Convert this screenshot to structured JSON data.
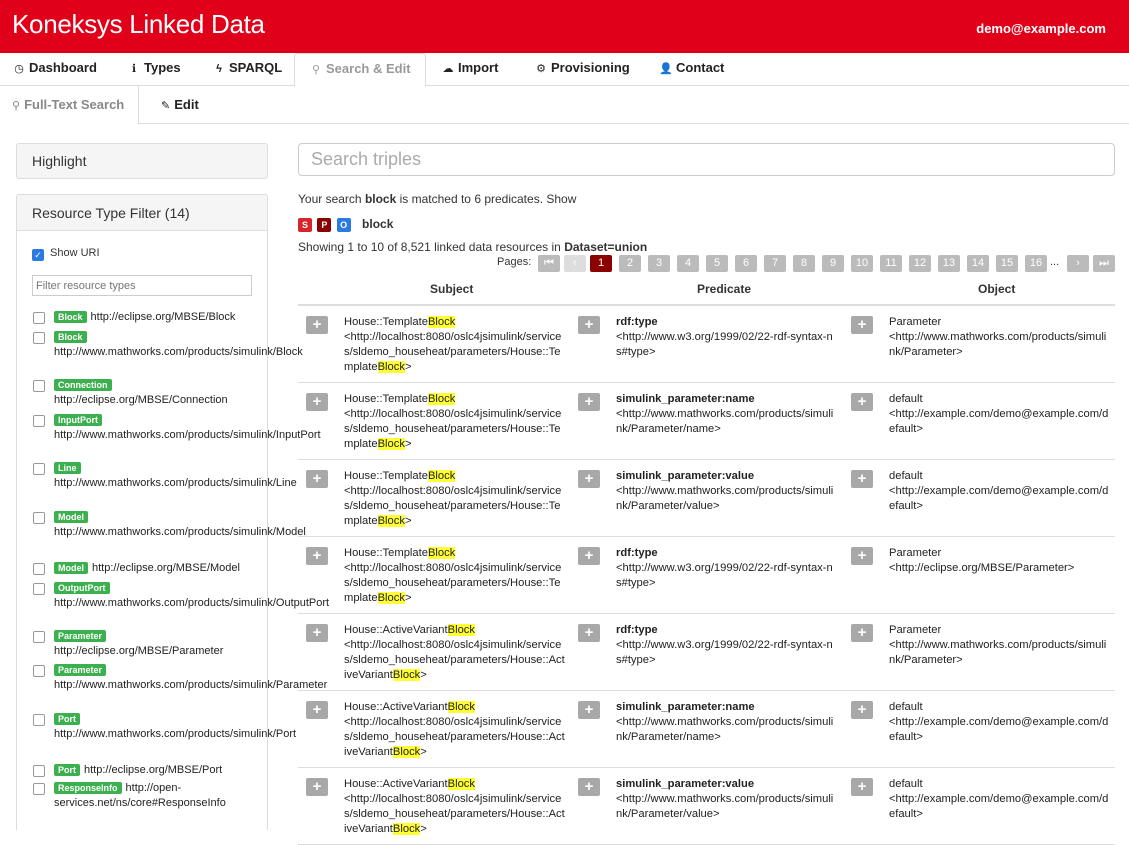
{
  "app": {
    "title": "Koneksys Linked Data",
    "user": "demo@example.com"
  },
  "nav": {
    "items": [
      {
        "label": "Dashboard",
        "icon": "dashboard-icon",
        "glyph": "◷"
      },
      {
        "label": "Types",
        "icon": "info-icon",
        "glyph": "ℹ"
      },
      {
        "label": "SPARQL",
        "icon": "bolt-icon",
        "glyph": "ϟ"
      },
      {
        "label": "Search & Edit",
        "icon": "search-icon",
        "glyph": "⚲"
      },
      {
        "label": "Import",
        "icon": "cloud-upload-icon",
        "glyph": "☁"
      },
      {
        "label": "Provisioning",
        "icon": "gear-icon",
        "glyph": "⚙"
      },
      {
        "label": "Contact",
        "icon": "user-icon",
        "glyph": "👤"
      }
    ]
  },
  "subnav": {
    "fulltext": "Full-Text Search",
    "edit": "Edit"
  },
  "sidebar": {
    "highlight": "Highlight",
    "filter_title": "Resource Type Filter (14)",
    "show_uri": "Show URI",
    "filter_placeholder": "Filter resource types",
    "types": [
      {
        "badge": "Block",
        "uri": "http://eclipse.org/MBSE/Block"
      },
      {
        "badge": "Block",
        "uri": "http://www.mathworks.com/products/simulink/Block"
      },
      {
        "badge": "Connection",
        "uri": "http://eclipse.org/MBSE/Connection"
      },
      {
        "badge": "InputPort",
        "uri": "http://www.mathworks.com/products/simulink/InputPort"
      },
      {
        "badge": "Line",
        "uri": "http://www.mathworks.com/products/simulink/Line"
      },
      {
        "badge": "Model",
        "uri": "http://www.mathworks.com/products/simulink/Model"
      },
      {
        "badge": "Model",
        "uri": "http://eclipse.org/MBSE/Model"
      },
      {
        "badge": "OutputPort",
        "uri": "http://www.mathworks.com/products/simulink/OutputPort"
      },
      {
        "badge": "Parameter",
        "uri": "http://eclipse.org/MBSE/Parameter"
      },
      {
        "badge": "Parameter",
        "uri": "http://www.mathworks.com/products/simulink/Parameter"
      },
      {
        "badge": "Port",
        "uri": "http://www.mathworks.com/products/simulink/Port"
      },
      {
        "badge": "Port",
        "uri": "http://eclipse.org/MBSE/Port"
      },
      {
        "badge": "ResponseInfo",
        "uri": "http://open-services.net/ns/core#ResponseInfo"
      }
    ]
  },
  "search": {
    "placeholder": "Search triples",
    "info_prefix": "Your search ",
    "term": "block",
    "info_suffix": " is matched to 6 predicates. Show",
    "spo": [
      "S",
      "P",
      "O"
    ],
    "spo_colors": [
      "#d9242b",
      "#8b0000",
      "#2a7ae2"
    ],
    "showing_prefix": "Showing 1 to 10 of 8,521 linked data resources in ",
    "dataset": "Dataset=union",
    "pages_label": "Pages:",
    "pages": [
      "1",
      "2",
      "3",
      "4",
      "5",
      "6",
      "7",
      "8",
      "9",
      "10",
      "11",
      "12",
      "13",
      "14",
      "15",
      "16"
    ],
    "current_page": "1",
    "ellipsis": "..."
  },
  "table": {
    "headers": {
      "subject": "Subject",
      "predicate": "Predicate",
      "object": "Object"
    },
    "rows": [
      {
        "s_pre": "House::Template",
        "s_hl": "Block",
        "s_mid": "<http://localhost:8080/oslc4jsimulink/services/sldemo_househeat/parameters/House::Template",
        "s_hl2": "Block",
        "s_end": ">",
        "p_name": "rdf:type",
        "p_uri": "<http://www.w3.org/1999/02/22-rdf-syntax-ns#type>",
        "o_name": "Parameter",
        "o_uri": "<http://www.mathworks.com/products/simulink/Parameter>"
      },
      {
        "s_pre": "House::Template",
        "s_hl": "Block",
        "s_mid": "<http://localhost:8080/oslc4jsimulink/services/sldemo_househeat/parameters/House::Template",
        "s_hl2": "Block",
        "s_end": ">",
        "p_name": "simulink_parameter:name",
        "p_uri": "<http://www.mathworks.com/products/simulink/Parameter/name>",
        "o_name": "default",
        "o_uri": "<http://example.com/demo@example.com/default>"
      },
      {
        "s_pre": "House::Template",
        "s_hl": "Block",
        "s_mid": "<http://localhost:8080/oslc4jsimulink/services/sldemo_househeat/parameters/House::Template",
        "s_hl2": "Block",
        "s_end": ">",
        "p_name": "simulink_parameter:value",
        "p_uri": "<http://www.mathworks.com/products/simulink/Parameter/value>",
        "o_name": "default",
        "o_uri": "<http://example.com/demo@example.com/default>"
      },
      {
        "s_pre": "House::Template",
        "s_hl": "Block",
        "s_mid": "<http://localhost:8080/oslc4jsimulink/services/sldemo_househeat/parameters/House::Template",
        "s_hl2": "Block",
        "s_end": ">",
        "p_name": "rdf:type",
        "p_uri": "<http://www.w3.org/1999/02/22-rdf-syntax-ns#type>",
        "o_name": "Parameter",
        "o_uri": "<http://eclipse.org/MBSE/Parameter>"
      },
      {
        "s_pre": "House::ActiveVariant",
        "s_hl": "Block",
        "s_mid": "<http://localhost:8080/oslc4jsimulink/services/sldemo_househeat/parameters/House::ActiveVariant",
        "s_hl2": "Block",
        "s_end": ">",
        "p_name": "rdf:type",
        "p_uri": "<http://www.w3.org/1999/02/22-rdf-syntax-ns#type>",
        "o_name": "Parameter",
        "o_uri": "<http://www.mathworks.com/products/simulink/Parameter>"
      },
      {
        "s_pre": "House::ActiveVariant",
        "s_hl": "Block",
        "s_mid": "<http://localhost:8080/oslc4jsimulink/services/sldemo_househeat/parameters/House::ActiveVariant",
        "s_hl2": "Block",
        "s_end": ">",
        "p_name": "simulink_parameter:name",
        "p_uri": "<http://www.mathworks.com/products/simulink/Parameter/name>",
        "o_name": "default",
        "o_uri": "<http://example.com/demo@example.com/default>"
      },
      {
        "s_pre": "House::ActiveVariant",
        "s_hl": "Block",
        "s_mid": "<http://localhost:8080/oslc4jsimulink/services/sldemo_househeat/parameters/House::ActiveVariant",
        "s_hl2": "Block",
        "s_end": ">",
        "p_name": "simulink_parameter:value",
        "p_uri": "<http://www.mathworks.com/products/simulink/Parameter/value>",
        "o_name": "default",
        "o_uri": "<http://example.com/demo@example.com/default>"
      }
    ]
  }
}
